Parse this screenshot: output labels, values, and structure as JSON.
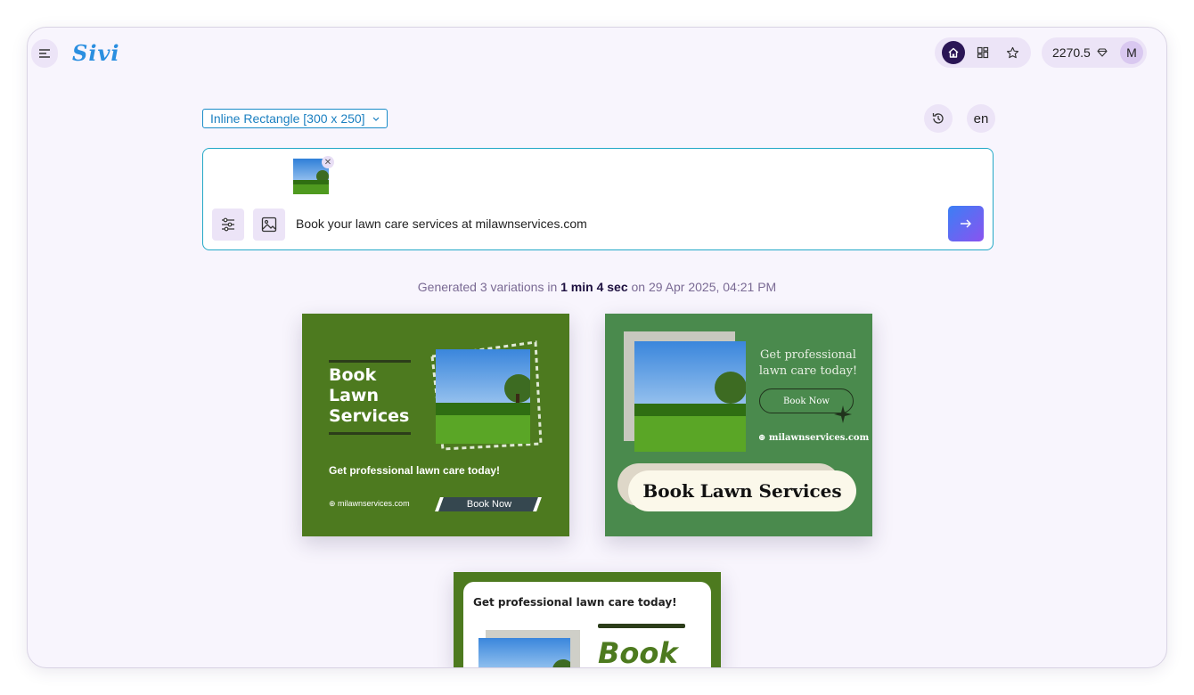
{
  "app": {
    "name": "Sivi",
    "credits": "2270.5",
    "avatar_initial": "M"
  },
  "nav": {
    "items": [
      "home-icon",
      "templates-icon",
      "favorites-icon"
    ],
    "accent": "#2b1656"
  },
  "toolbar": {
    "size_select": "Inline Rectangle [300 x 250]",
    "language": "en"
  },
  "prompt": {
    "text": "Book your lawn care services at milawnservices.com",
    "attachment": "lawn-photo"
  },
  "generation": {
    "prefix": "Generated 3 variations in",
    "duration": "1 min 4 sec",
    "middle": "on",
    "timestamp": "29 Apr 2025, 04:21 PM"
  },
  "variations": [
    {
      "title_lines": [
        "Book",
        "Lawn",
        "Services"
      ],
      "subtitle": "Get professional lawn care today!",
      "url": "milawnservices.com",
      "cta": "Book Now",
      "bg": "#4d7a1f"
    },
    {
      "subtitle_lines": [
        "Get professional",
        "lawn care today!"
      ],
      "cta": "Book Now",
      "url": "milawnservices.com",
      "title": "Book Lawn Services",
      "bg": "#4a8a4d"
    },
    {
      "subtitle": "Get professional lawn care today!",
      "title_partial": "Book",
      "bg": "#4d7a1f"
    }
  ]
}
